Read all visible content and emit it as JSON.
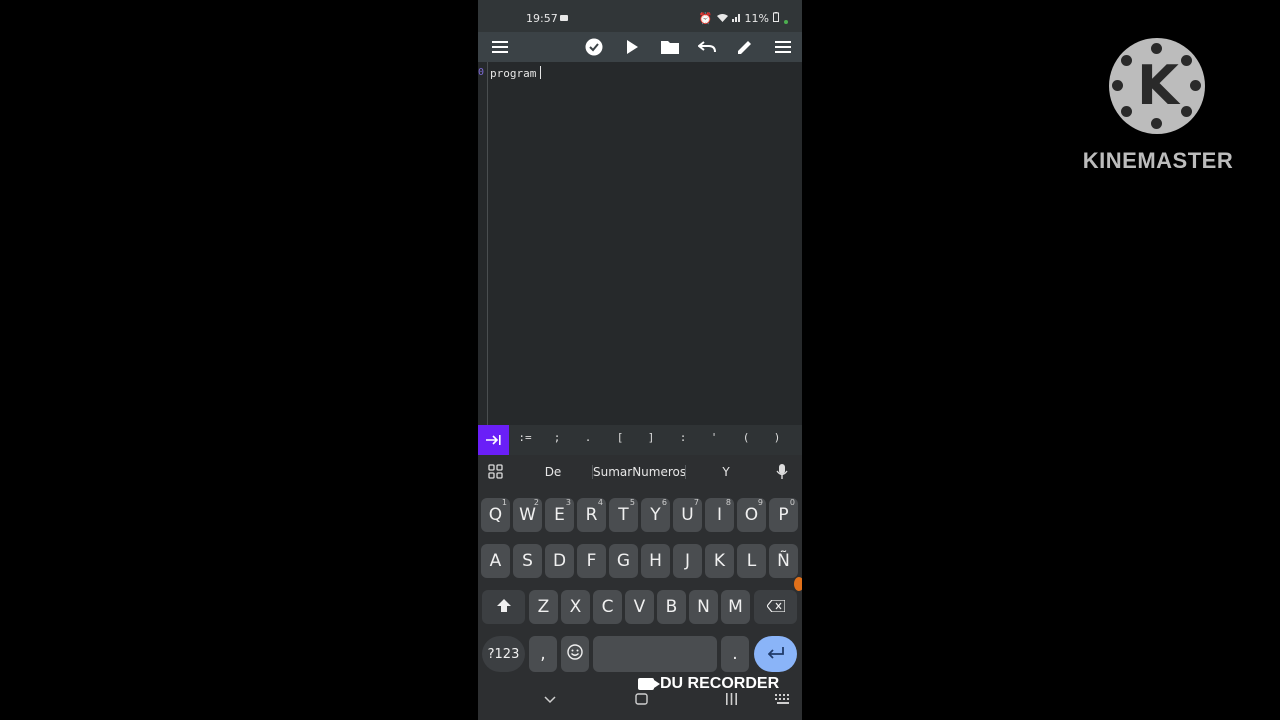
{
  "status_bar": {
    "time": "19:57",
    "battery": "11%"
  },
  "toolbar": {
    "icons": [
      "menu-icon",
      "check-circle-icon",
      "play-icon",
      "folder-icon",
      "undo-icon",
      "pencil-icon",
      "overflow-menu-icon"
    ]
  },
  "editor": {
    "line_number": "0",
    "code": "program"
  },
  "symbol_bar": {
    "tab_icon": "tab-indent-icon",
    "symbols": [
      ":=",
      ";",
      ".",
      "[",
      "]",
      ":",
      "'",
      "(",
      ")"
    ]
  },
  "keyboard": {
    "suggestions": [
      "De",
      "SumarNumeros",
      "Y"
    ],
    "row1": [
      {
        "label": "Q",
        "hint": "1"
      },
      {
        "label": "W",
        "hint": "2"
      },
      {
        "label": "E",
        "hint": "3"
      },
      {
        "label": "R",
        "hint": "4"
      },
      {
        "label": "T",
        "hint": "5"
      },
      {
        "label": "Y",
        "hint": "6"
      },
      {
        "label": "U",
        "hint": "7"
      },
      {
        "label": "I",
        "hint": "8"
      },
      {
        "label": "O",
        "hint": "9"
      },
      {
        "label": "P",
        "hint": "0"
      }
    ],
    "row2": [
      "A",
      "S",
      "D",
      "F",
      "G",
      "H",
      "J",
      "K",
      "L",
      "Ñ"
    ],
    "row3": [
      "Z",
      "X",
      "C",
      "V",
      "B",
      "N",
      "M"
    ],
    "numbers_key": "?123",
    "comma_key": ",",
    "period_key": "."
  },
  "watermark_du": "DU RECORDER",
  "watermark_kinemaster": "KINEMASTER"
}
